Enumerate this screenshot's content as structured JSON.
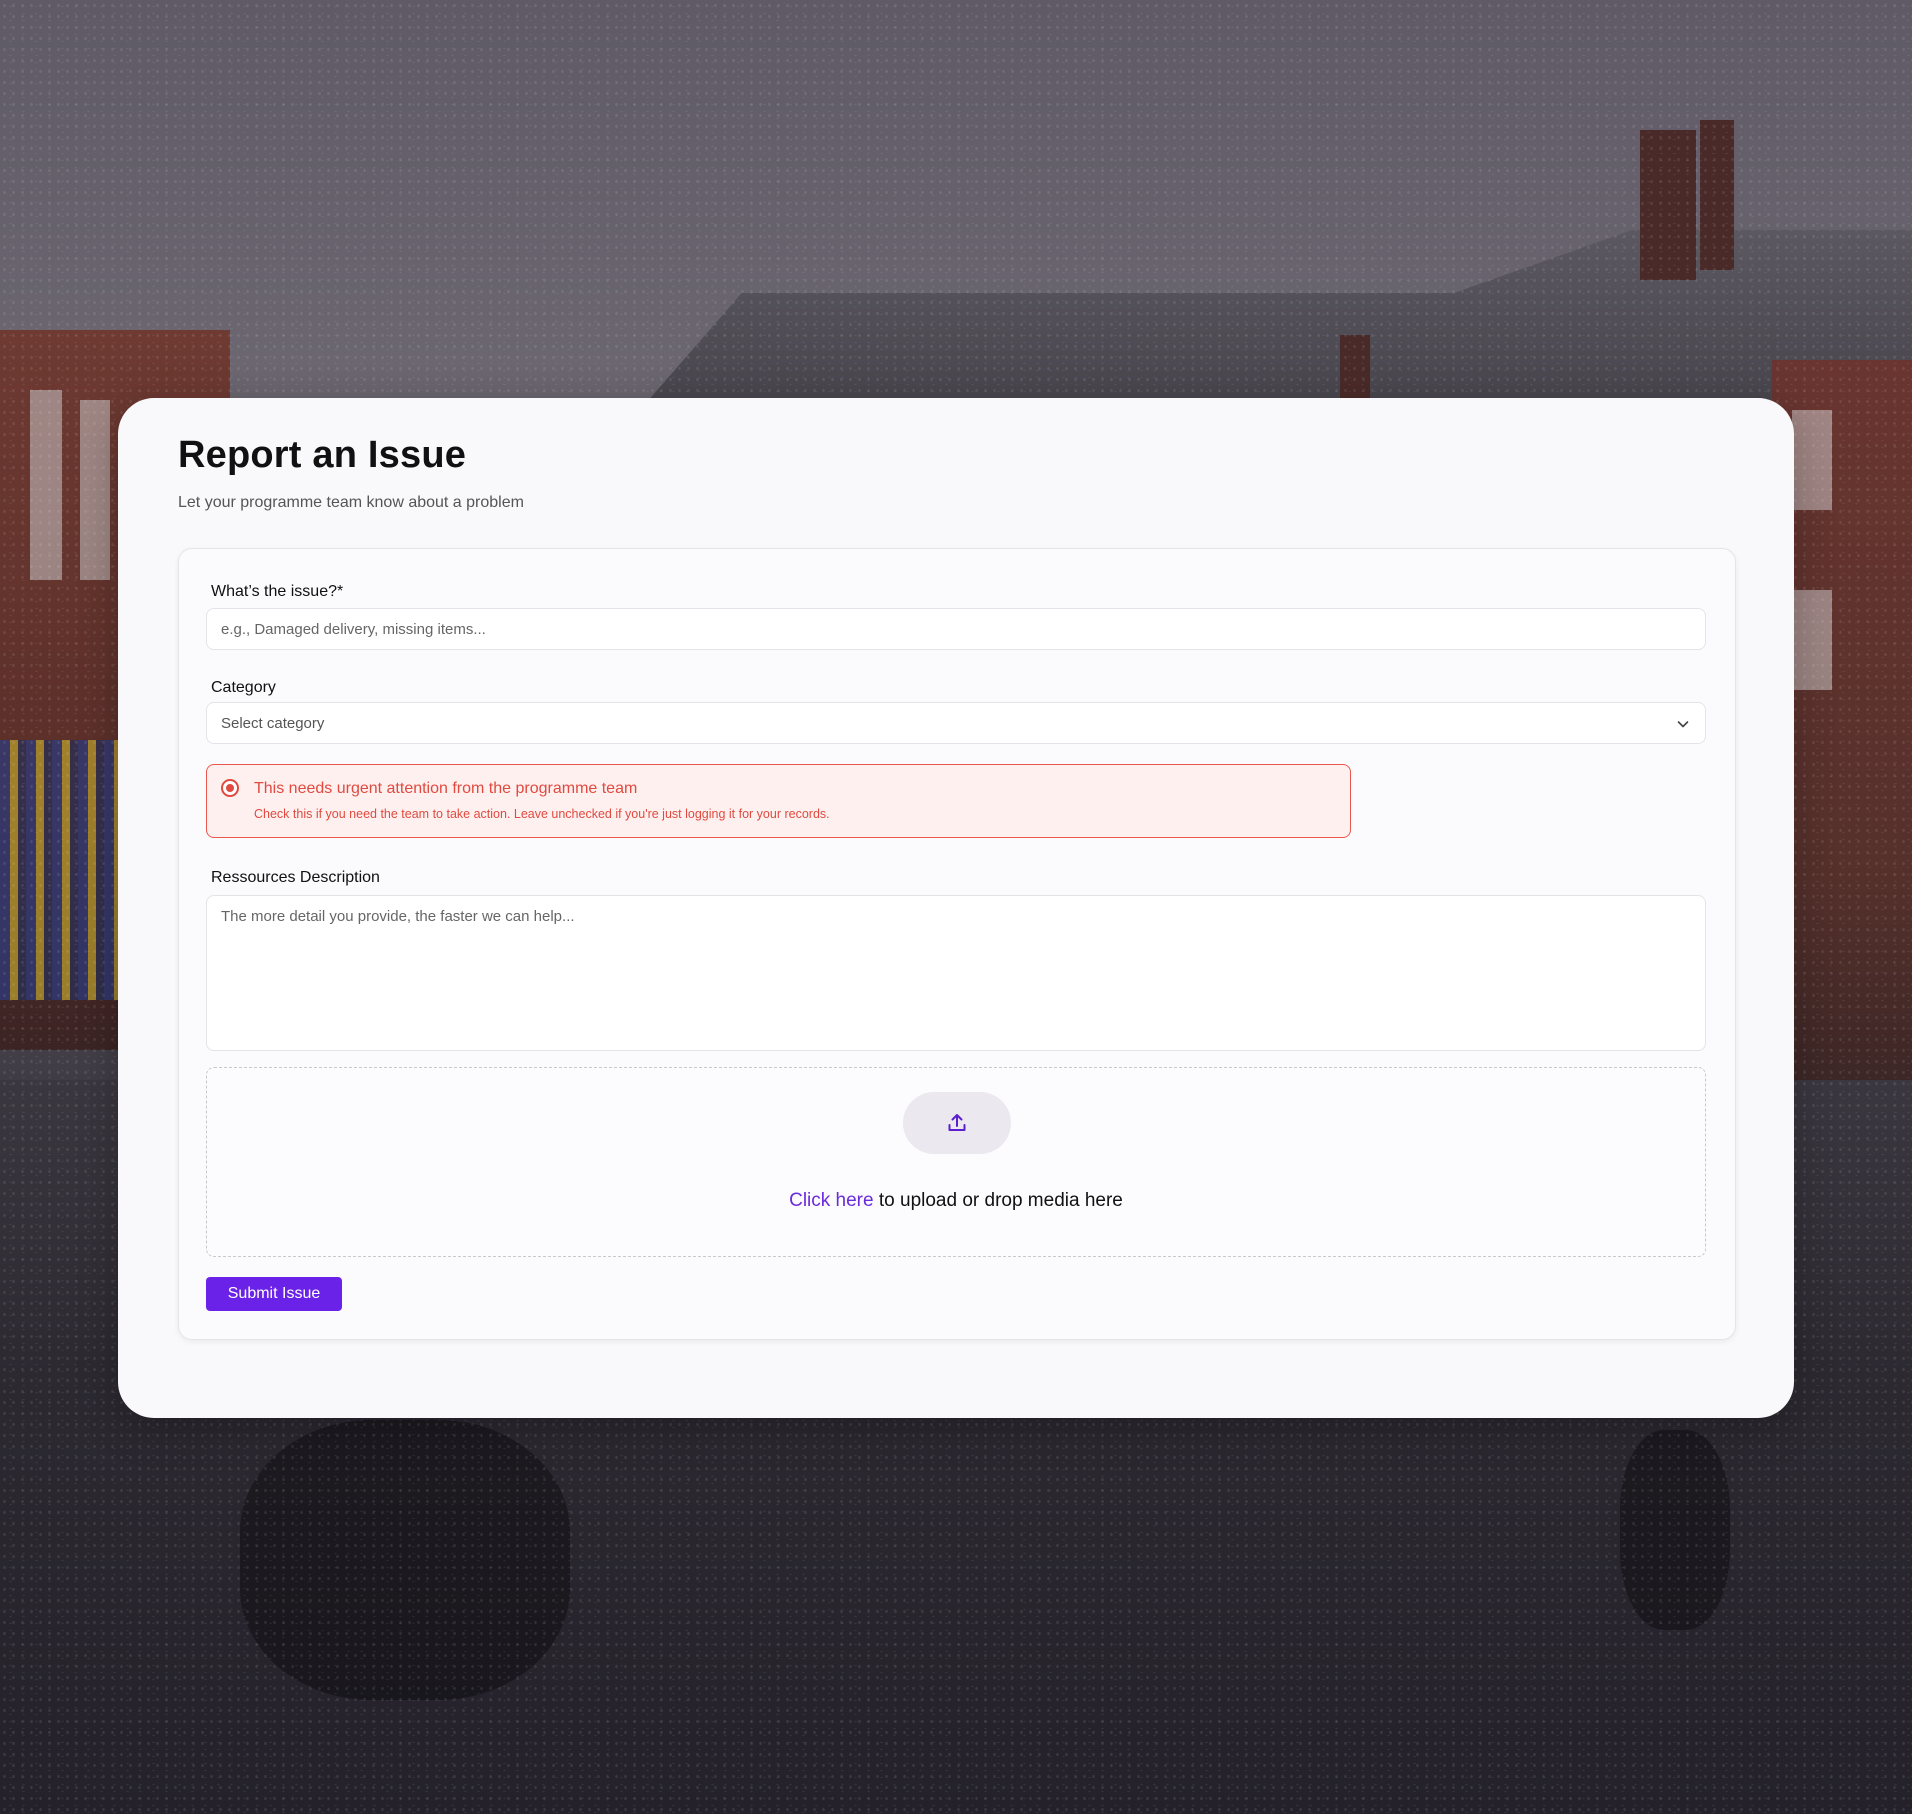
{
  "page": {
    "title": "Report an Issue",
    "subtitle": "Let your programme team know about a problem"
  },
  "form": {
    "issue": {
      "label": "What’s  the issue?*",
      "placeholder": "e.g., Damaged delivery, missing items...",
      "value": ""
    },
    "category": {
      "label": "Category",
      "selected": "Select category",
      "icon": "chevron-down-icon"
    },
    "urgent": {
      "checked": true,
      "title": "This needs urgent attention from the programme team",
      "help": "Check this if you need the team to take action. Leave unchecked if you're just logging it for your records."
    },
    "description": {
      "label": "Ressources Description",
      "placeholder": "The more detail you provide, the faster we can help...",
      "value": ""
    },
    "upload": {
      "icon": "upload-icon",
      "link_text": "Click here",
      "rest_text": " to upload or drop media here"
    },
    "submit_label": "Submit Issue"
  },
  "colors": {
    "accent": "#6a22e8",
    "link": "#6a2bdd",
    "danger": "#e04a3f",
    "danger_bg": "#fff0f0"
  }
}
